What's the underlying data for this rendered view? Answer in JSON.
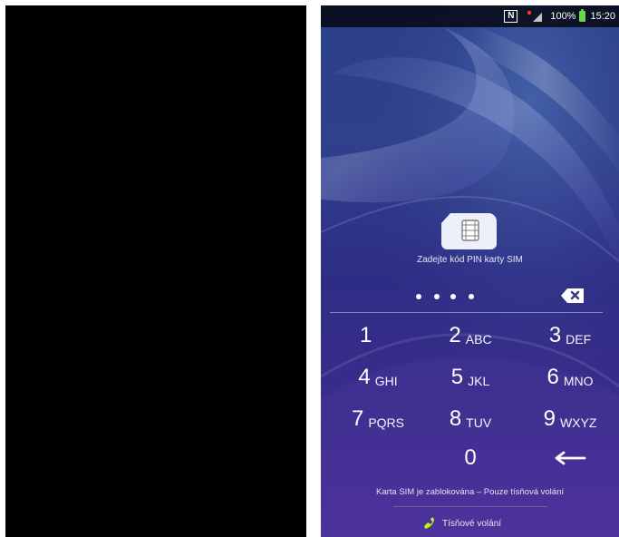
{
  "statusbar": {
    "nfc_icon": "nfc-icon",
    "battery": "100%",
    "time": "15:20"
  },
  "sim_unlock": {
    "instruction": "Zadejte kód PIN karty SIM",
    "entered_digits": 4
  },
  "keypad": {
    "keys": [
      {
        "digit": "1",
        "letters": ""
      },
      {
        "digit": "2",
        "letters": "ABC"
      },
      {
        "digit": "3",
        "letters": "DEF"
      },
      {
        "digit": "4",
        "letters": "GHI"
      },
      {
        "digit": "5",
        "letters": "JKL"
      },
      {
        "digit": "6",
        "letters": "MNO"
      },
      {
        "digit": "7",
        "letters": "PQRS"
      },
      {
        "digit": "8",
        "letters": "TUV"
      },
      {
        "digit": "9",
        "letters": "WXYZ"
      },
      {
        "digit": "0",
        "letters": ""
      }
    ],
    "delete_icon": "backspace-icon",
    "enter_icon": "enter-arrow-icon"
  },
  "footer": {
    "locked_message": "Karta SIM je zablokována – Pouze tísňová volání",
    "emergency_label": "Tísňové volání"
  },
  "colors": {
    "background_left": "#000000",
    "phone_purple": "#2f2d86",
    "battery_green": "#69d64b",
    "emergency_icon": "#c7f01e"
  }
}
